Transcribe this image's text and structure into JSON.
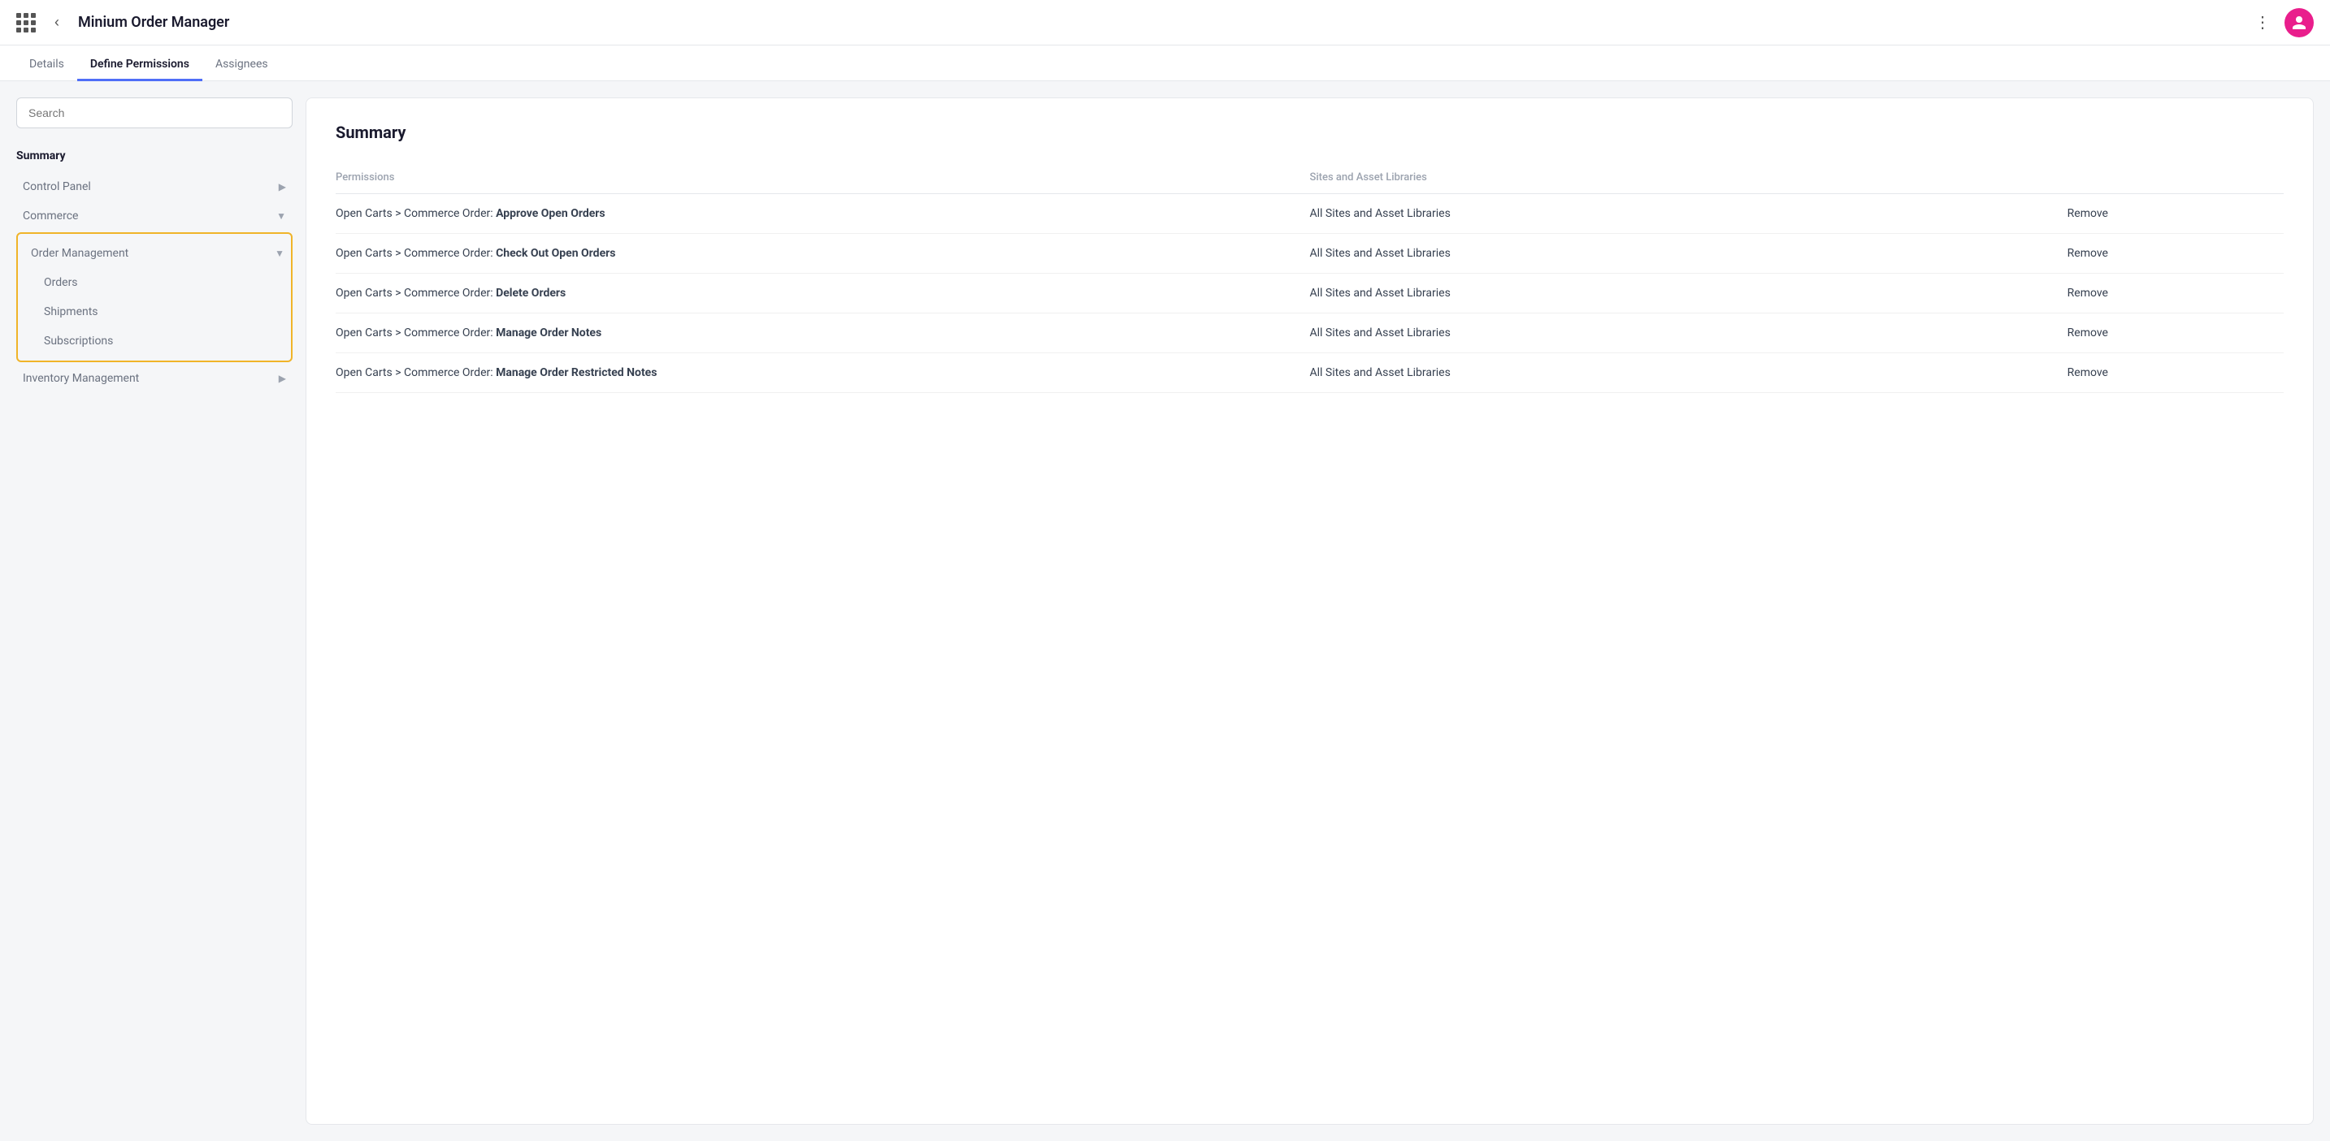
{
  "header": {
    "app_title": "Minium Order Manager",
    "more_icon": "⋮",
    "avatar_icon": "👤"
  },
  "tabs": [
    {
      "id": "details",
      "label": "Details",
      "active": false
    },
    {
      "id": "define-permissions",
      "label": "Define Permissions",
      "active": true
    },
    {
      "id": "assignees",
      "label": "Assignees",
      "active": false
    }
  ],
  "sidebar": {
    "search_placeholder": "Search",
    "summary_label": "Summary",
    "items": [
      {
        "id": "control-panel",
        "label": "Control Panel",
        "chevron": "▶",
        "type": "parent"
      },
      {
        "id": "commerce",
        "label": "Commerce",
        "chevron": "▼",
        "type": "parent"
      },
      {
        "id": "order-management-group",
        "highlighted": true,
        "items": [
          {
            "id": "order-management",
            "label": "Order Management",
            "chevron": "▼",
            "type": "parent"
          },
          {
            "id": "orders",
            "label": "Orders",
            "type": "child"
          },
          {
            "id": "shipments",
            "label": "Shipments",
            "type": "child"
          },
          {
            "id": "subscriptions",
            "label": "Subscriptions",
            "type": "child"
          }
        ]
      },
      {
        "id": "inventory-management",
        "label": "Inventory Management",
        "chevron": "▶",
        "type": "parent"
      }
    ]
  },
  "content": {
    "title": "Summary",
    "table": {
      "col_permissions": "Permissions",
      "col_sites": "Sites and Asset Libraries",
      "rows": [
        {
          "permission_prefix": "Open Carts > Commerce Order:",
          "permission_bold": "Approve Open Orders",
          "sites": "All Sites and Asset Libraries",
          "action": "Remove"
        },
        {
          "permission_prefix": "Open Carts > Commerce Order:",
          "permission_bold": "Check Out Open Orders",
          "sites": "All Sites and Asset Libraries",
          "action": "Remove"
        },
        {
          "permission_prefix": "Open Carts > Commerce Order:",
          "permission_bold": "Delete Orders",
          "sites": "All Sites and Asset Libraries",
          "action": "Remove"
        },
        {
          "permission_prefix": "Open Carts > Commerce Order:",
          "permission_bold": "Manage Order Notes",
          "sites": "All Sites and Asset Libraries",
          "action": "Remove"
        },
        {
          "permission_prefix": "Open Carts > Commerce Order:",
          "permission_bold": "Manage Order Restricted Notes",
          "sites": "All Sites and Asset Libraries",
          "action": "Remove"
        }
      ]
    }
  }
}
